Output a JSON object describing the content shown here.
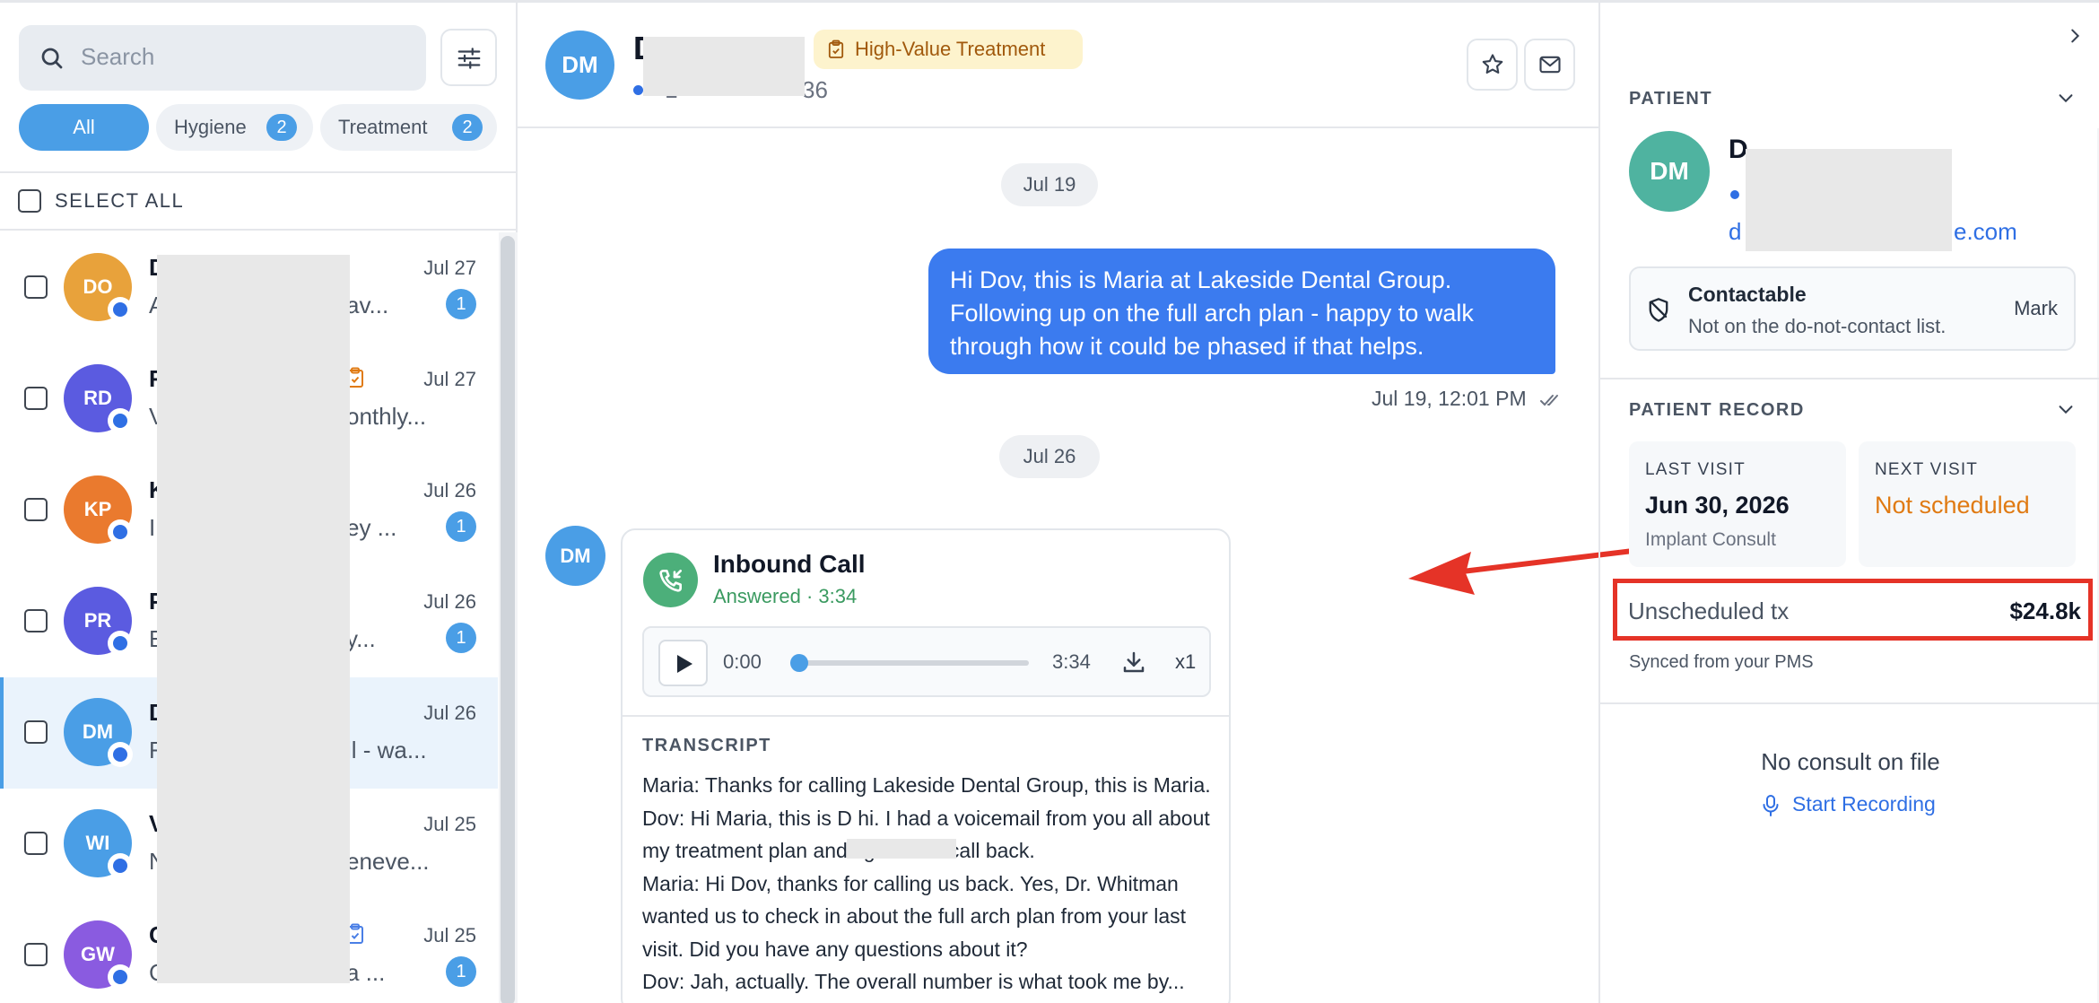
{
  "search": {
    "placeholder": "Search"
  },
  "filters": {
    "all_label": "All",
    "hygiene_label": "Hygiene",
    "hygiene_count": "2",
    "treatment_label": "Treatment",
    "treatment_count": "2"
  },
  "select_all_label": "SELECT ALL",
  "conversations": [
    {
      "initials": "DO",
      "avatar_color": "#e8a23b",
      "name": "D",
      "preview": "A",
      "preview_tail": "av...",
      "date": "Jul 27",
      "unread": "1"
    },
    {
      "initials": "RD",
      "avatar_color": "#5b5be0",
      "name": "R",
      "preview": "V",
      "preview_tail": "onthly...",
      "date": "Jul 27",
      "unread": ""
    },
    {
      "initials": "KP",
      "avatar_color": "#ea7a2e",
      "name": "K",
      "preview": "I",
      "preview_tail": "ey ...",
      "date": "Jul 26",
      "unread": "1"
    },
    {
      "initials": "PR",
      "avatar_color": "#5b5be0",
      "name": "P",
      "preview": "E",
      "preview_tail": "y...",
      "date": "Jul 26",
      "unread": "1"
    },
    {
      "initials": "DM",
      "avatar_color": "#4a9ee6",
      "name": "D",
      "preview": "F",
      "preview_tail": "il - wa...",
      "date": "Jul 26",
      "unread": ""
    },
    {
      "initials": "WI",
      "avatar_color": "#4a9ee6",
      "name": "V",
      "preview": "N",
      "preview_tail": "eneve...",
      "date": "Jul 25",
      "unread": ""
    },
    {
      "initials": "GW",
      "avatar_color": "#8a5be0",
      "name": "C",
      "preview": "C",
      "preview_tail": "a ...",
      "date": "Jul 25",
      "unread": "1"
    }
  ],
  "thread": {
    "contact_initials": "DM",
    "contact_name": "D",
    "contact_phone": "+1",
    "contact_phone_tail": "36",
    "badge": "High-Value Treatment",
    "date_chip_1": "Jul 19",
    "outgoing_message": "Hi Dov, this is Maria at Lakeside Dental Group. Following up on the full arch plan - happy to walk through how it could be phased if that helps.",
    "outgoing_meta": "Jul 19, 12:01 PM",
    "date_chip_2": "Jul 26",
    "call": {
      "title": "Inbound Call",
      "subtitle": "Answered · 3:34",
      "time_current": "0:00",
      "time_total": "3:34",
      "speed": "x1",
      "transcript_label": "TRANSCRIPT",
      "transcript_lines": [
        "Maria: Thanks for calling Lakeside Dental Group, this is Maria.",
        "Dov: Hi Maria, this is D        hi. I had a voicemail from you all about my treatment plan and figured I'd call back.",
        "Maria: Hi Dov, thanks for calling us back. Yes, Dr. Whitman wanted us to check in about the full arch plan from your last visit. Did you have any questions about it?",
        "Dov: Jah, actually. The overall number is what took me by..."
      ]
    }
  },
  "patient": {
    "section_label": "PATIENT",
    "initials": "DM",
    "name": "D",
    "email": "d",
    "email_tail": "e.com",
    "contact_title": "Contactable",
    "contact_subtitle": "Not on the do-not-contact list.",
    "mark_label": "Mark"
  },
  "record": {
    "section_label": "PATIENT RECORD",
    "last_visit_label": "LAST VISIT",
    "last_visit_value": "Jun 30, 2026",
    "last_visit_sub": "Implant Consult",
    "next_visit_label": "NEXT VISIT",
    "next_visit_value": "Not scheduled",
    "unscheduled_label": "Unscheduled tx",
    "unscheduled_value": "$24.8k",
    "synced_note": "Synced from your PMS"
  },
  "consult": {
    "empty_text": "No consult on file",
    "record_label": "Start Recording"
  },
  "colors": {
    "accent": "#4a9ee6",
    "message_blue": "#3b7bef",
    "call_green": "#4caf7a",
    "highlight_red": "#e53327",
    "warning_orange": "#e07a12"
  }
}
